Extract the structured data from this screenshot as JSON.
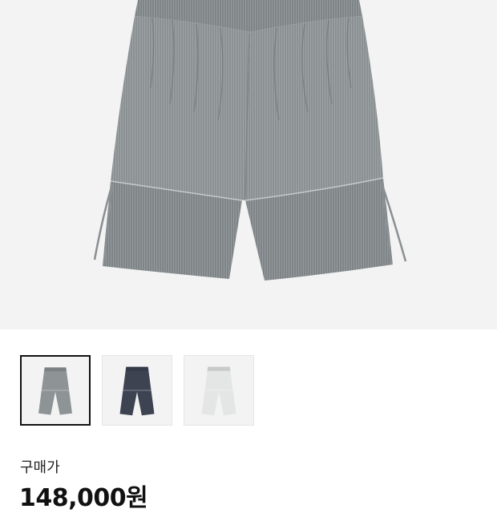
{
  "product": {
    "main_image": "gray-pinstripe-pants-image",
    "thumbnails": [
      {
        "icon": "gray-pants-thumbnail",
        "color": "#8e9396",
        "selected": true
      },
      {
        "icon": "navy-pants-thumbnail",
        "color": "#3e4352",
        "selected": false
      },
      {
        "icon": "white-pants-thumbnail",
        "color": "#e4e6e6",
        "selected": false
      }
    ],
    "price_label": "구매가",
    "price": "148,000원"
  }
}
